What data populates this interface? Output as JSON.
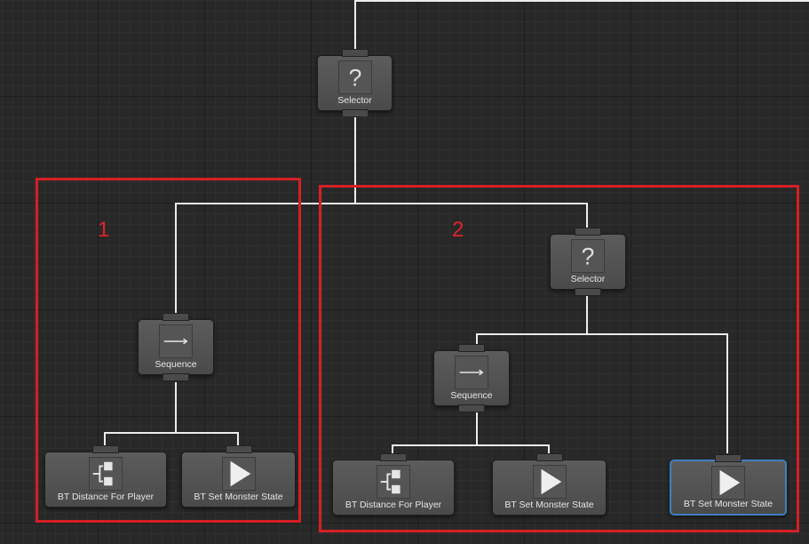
{
  "frames": [
    {
      "label": "1"
    },
    {
      "label": "2"
    }
  ],
  "nodes": {
    "root_selector": {
      "label": "Selector",
      "icon": "question-mark-icon"
    },
    "seq_left": {
      "label": "Sequence",
      "icon": "arrow-right-icon"
    },
    "cond_left": {
      "label": "BT   Distance For Player",
      "icon": "tree-branch-icon"
    },
    "action_left": {
      "label": "BT   Set Monster State",
      "icon": "play-icon"
    },
    "right_selector": {
      "label": "Selector",
      "icon": "question-mark-icon"
    },
    "seq_right": {
      "label": "Sequence",
      "icon": "arrow-right-icon"
    },
    "cond_right": {
      "label": "BT   Distance For Player",
      "icon": "tree-branch-icon"
    },
    "action_right": {
      "label": "BT   Set Monster State",
      "icon": "play-icon"
    },
    "action_selected": {
      "label": "BT   Set Monster State",
      "icon": "play-icon"
    }
  },
  "icons": {
    "question_glyph": "?"
  },
  "colors": {
    "wire": "#ececec",
    "frame": "#d61f26",
    "selected_border": "#3f7fc0"
  }
}
